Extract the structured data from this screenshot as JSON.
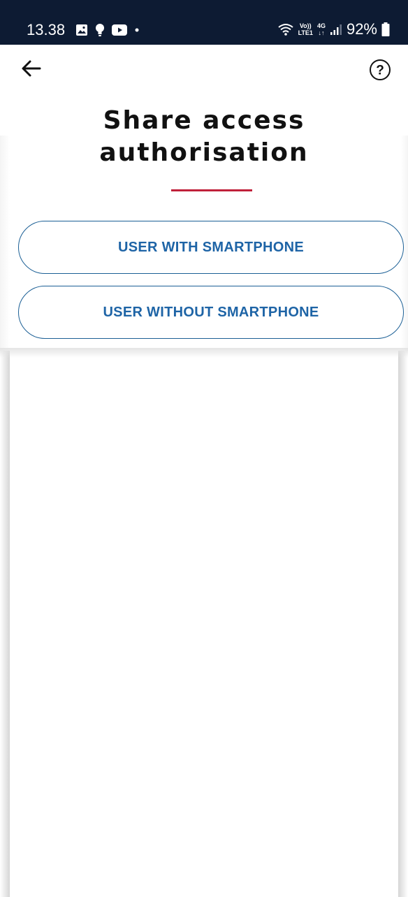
{
  "status_bar": {
    "time": "13.38",
    "left_icons": [
      "gallery-icon",
      "bulb-icon",
      "youtube-icon",
      "dot-icon"
    ],
    "right_icons": [
      "wifi-icon",
      "volte-icon",
      "4g-icon",
      "signal-icon",
      "battery-icon"
    ],
    "volte_top": "Vo))",
    "volte_bottom": "LTE1",
    "network_label": "4G",
    "battery_text": "92%"
  },
  "header": {
    "back_icon": "arrow-left-icon",
    "help_icon": "question-circle-icon",
    "help_glyph": "?"
  },
  "page": {
    "title": "Share access\nauthorisation",
    "accent_color": "#c0203a"
  },
  "options": {
    "with_smartphone_label": "USER WITH SMARTPHONE",
    "without_smartphone_label": "USER WITHOUT SMARTPHONE",
    "button_color": "#1e64a6"
  }
}
